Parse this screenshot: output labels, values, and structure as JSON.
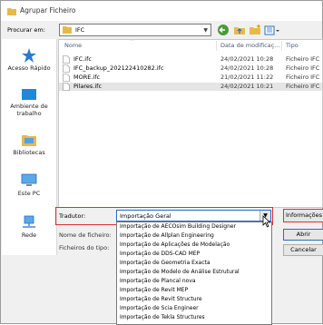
{
  "window": {
    "title": "Agrupar Ficheiro"
  },
  "lookin": {
    "label": "Procurar em:",
    "value": "IFC"
  },
  "places": [
    {
      "label": "Acesso Rápido",
      "icon": "star-icon"
    },
    {
      "label": "Ambiente de trabalho",
      "icon": "desktop-icon"
    },
    {
      "label": "Bibliotecas",
      "icon": "library-icon"
    },
    {
      "label": "Este PC",
      "icon": "computer-icon"
    },
    {
      "label": "Rede",
      "icon": "network-icon"
    }
  ],
  "columns": {
    "name": "Nome",
    "date": "Data de modificaç...",
    "type": "Tipo"
  },
  "files": [
    {
      "name": "IFC.ifc",
      "date": "24/02/2021 10:28",
      "type": "Ficheiro IFC",
      "selected": false
    },
    {
      "name": "IFC_backup_202122410282.ifc",
      "date": "24/02/2021 10:28",
      "type": "Ficheiro IFC",
      "selected": false
    },
    {
      "name": "MORE.ifc",
      "date": "21/02/2021 11:22",
      "type": "Ficheiro IFC",
      "selected": false
    },
    {
      "name": "Pilares.ifc",
      "date": "24/02/2021 10:21",
      "type": "Ficheiro IFC",
      "selected": true
    }
  ],
  "translator": {
    "label": "Tradutor:",
    "value": "Importação Geral"
  },
  "filename": {
    "label": "Nome de ficheiro:"
  },
  "filetype": {
    "label": "Ficheiros do tipo:"
  },
  "buttons": {
    "info": "Informações",
    "open": "Abrir",
    "cancel": "Cancelar"
  },
  "translator_options": [
    "Importação de AECOsim Building Designer",
    "Importação de Allplan Engineering",
    "Importação de Aplicações de Modelação",
    "Importação de DDS-CAD MEP",
    "Importação de Geometria Exacta",
    "Importação de Modelo de Análise Estrutural",
    "Importação de Plancal nova",
    "Importação de Revit MEP",
    "Importação de Revit Structure",
    "Importação de Scia Engineer",
    "Importação de Tekla Structures"
  ],
  "colors": {
    "accent": "#2a6bc8",
    "highlight": "#e03030",
    "folder": "#e8b94a"
  }
}
